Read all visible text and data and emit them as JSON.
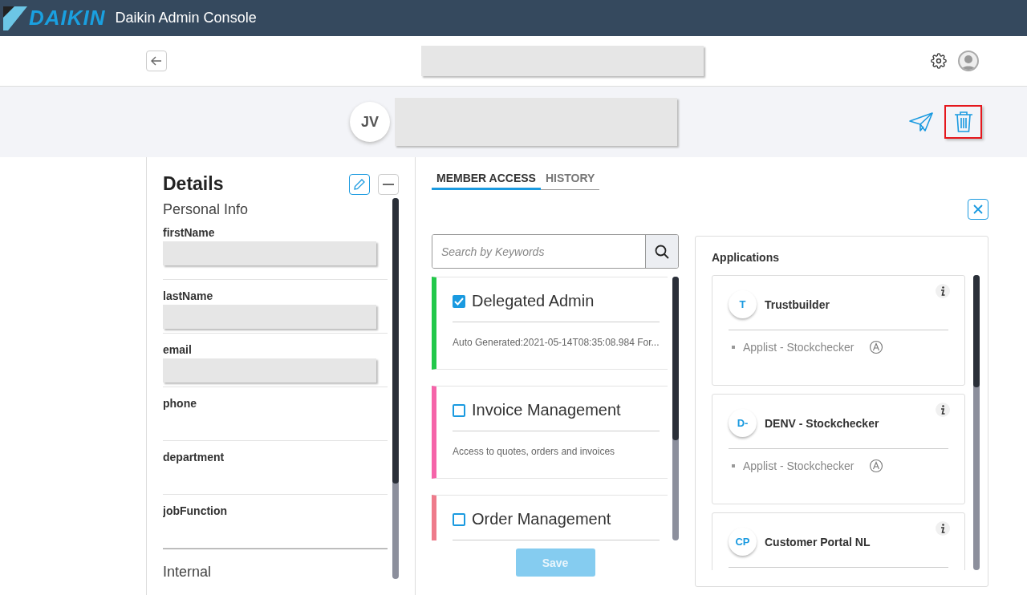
{
  "app_bar": {
    "brand": "DAIKIN",
    "title": "Daikin Admin Console"
  },
  "profile": {
    "initials": "JV"
  },
  "details": {
    "title": "Details",
    "sections": [
      {
        "title": "Personal Info",
        "fields": [
          {
            "label": "firstName",
            "redacted": true
          },
          {
            "label": "lastName",
            "redacted": true
          },
          {
            "label": "email",
            "redacted": true
          },
          {
            "label": "phone",
            "redacted": false
          },
          {
            "label": "department",
            "redacted": false
          },
          {
            "label": "jobFunction",
            "redacted": false
          }
        ]
      },
      {
        "title": "Internal"
      }
    ]
  },
  "tabs": [
    {
      "label": "MEMBER ACCESS",
      "selected": true
    },
    {
      "label": "HISTORY",
      "selected": false
    }
  ],
  "search": {
    "placeholder": "Search by Keywords"
  },
  "roles": [
    {
      "name": "Delegated Admin",
      "checked": true,
      "color": "#22c84a",
      "description": "Auto Generated:2021-05-14T08:35:08.984 For..."
    },
    {
      "name": "Invoice Management",
      "checked": false,
      "color": "#f564a9",
      "description": "Access to quotes, orders and invoices"
    },
    {
      "name": "Order Management",
      "checked": false,
      "color": "#ee7b8b"
    }
  ],
  "save": {
    "label": "Save",
    "disabled": true
  },
  "applications": {
    "title": "Applications",
    "items": [
      {
        "initials": "T",
        "name": "Trustbuilder",
        "entries": [
          "Applist - Stockchecker"
        ]
      },
      {
        "initials": "D-",
        "name": "DENV - Stockchecker",
        "entries": [
          "Applist - Stockchecker"
        ]
      },
      {
        "initials": "CP",
        "name": "Customer Portal NL"
      }
    ]
  }
}
